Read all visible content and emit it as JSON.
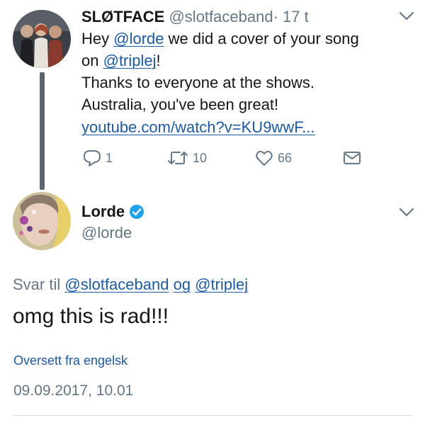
{
  "tweet1": {
    "display_name": "SLØTFACE",
    "handle": "@slotfaceband",
    "separator": "·",
    "time": "17 t",
    "text": {
      "hey": "Hey",
      "mention_lorde": "@lorde",
      "did_cover": "we did a cover of your song",
      "on": "on",
      "mention_triplej": "@triplej",
      "exclaim": "!",
      "line3": "Thanks to everyone at the shows.",
      "line4": "Australia, you've been great!",
      "link": "youtube.com/watch?v=KU9wwF..."
    },
    "actions": {
      "replies": "1",
      "retweets": "10",
      "likes": "66"
    }
  },
  "tweet2": {
    "display_name": "Lorde",
    "handle": "@lorde",
    "reply_prefix": "Svar til",
    "reply_user1": "@slotfaceband",
    "reply_and": "og",
    "reply_user2": "@triplej",
    "text": "omg this is rad!!!",
    "translate": "Oversett fra engelsk",
    "timestamp": "09.09.2017, 10.01"
  },
  "colors": {
    "text": "#14171a",
    "muted": "#657786",
    "link": "#1b5aa8",
    "verified": "#1da1f2",
    "thread_line": "#5c6670"
  }
}
